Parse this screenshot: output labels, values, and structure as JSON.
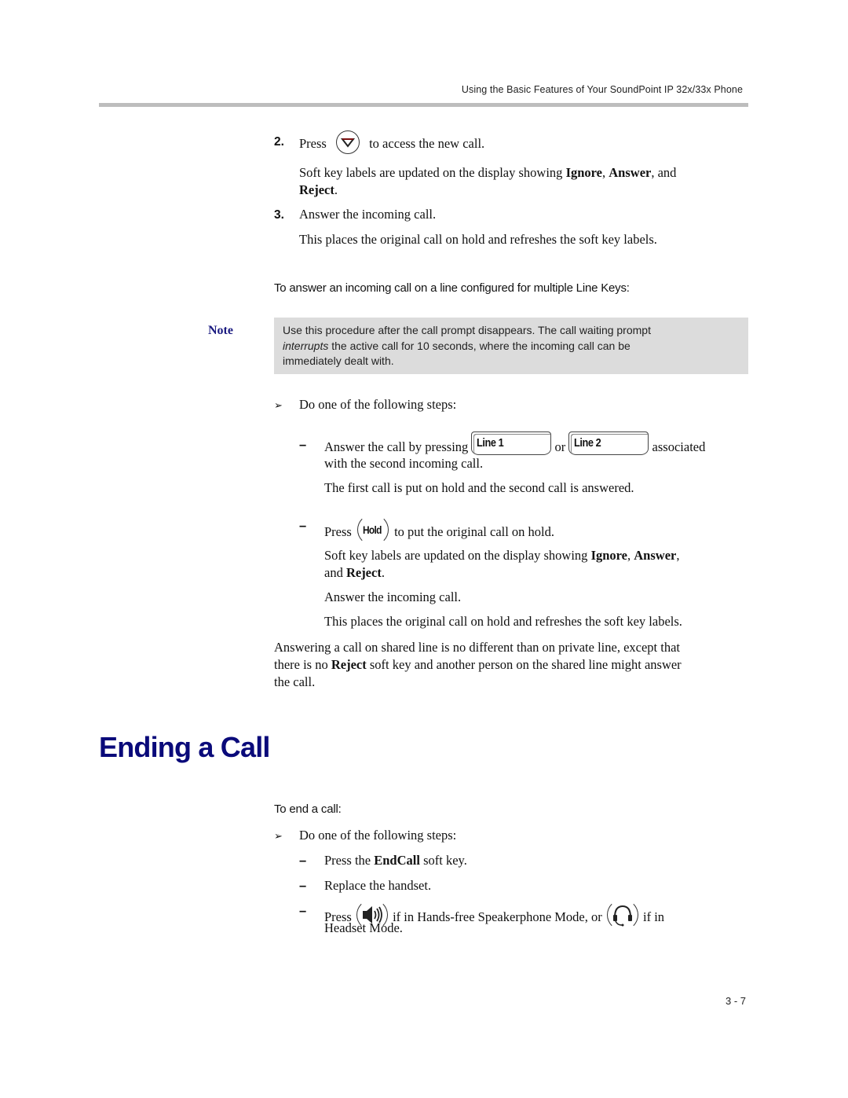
{
  "header": {
    "running_title": "Using the Basic Features of Your SoundPoint IP 32x/33x Phone"
  },
  "steps_top": [
    {
      "number": "2.",
      "pre": "Press",
      "icon": "down-arrow-key-icon",
      "post": "to access the new call.",
      "detail_pre": "Soft key labels are updated on the display showing ",
      "detail_bold1": "Ignore",
      "detail_sep1": ", ",
      "detail_bold2": "Answer",
      "detail_sep2": ", and",
      "detail_bold3": "Reject",
      "detail_end": "."
    },
    {
      "number": "3.",
      "text": "Answer the incoming call.",
      "detail": "This places the original call on hold and refreshes the soft key labels."
    }
  ],
  "procedure1": {
    "heading": "To answer an incoming call on a line configured for multiple Line Keys:",
    "note_label": "Note",
    "note_line1": "Use this procedure after the call prompt disappears. The call waiting prompt",
    "note_line2_italic": "interrupts",
    "note_line2_rest": " the active call for 10 seconds, where the incoming call can be",
    "note_line3": "immediately dealt with.",
    "bullet_marker": "➢",
    "bullet": "Do one of the following steps:",
    "options": [
      {
        "dash": "–",
        "pre": "Answer the call by pressing",
        "key1": "Line 1",
        "mid": "or",
        "key2": "Line 2",
        "post": "associated",
        "cont": "with the second incoming call.",
        "detail": "The first call is put on hold and the second call is answered."
      },
      {
        "dash": "–",
        "pre": "Press",
        "key": "Hold",
        "post": "to put the original call on hold.",
        "detail_pre": "Soft key labels are updated on the display showing ",
        "detail_bold1": "Ignore",
        "detail_sep1": ", ",
        "detail_bold2": "Answer",
        "detail_sep2": ",",
        "detail_line2_pre": "and ",
        "detail_bold3": "Reject",
        "detail_end": ".",
        "detail2": "Answer the incoming call.",
        "detail3": "This places the original call on hold and refreshes the soft key labels."
      }
    ],
    "shared_line_1": "Answering a call on shared line is no different than on private line, except that",
    "shared_line_2_pre": "there is no ",
    "shared_line_2_bold": "Reject",
    "shared_line_2_post": " soft key and another person on the shared line might answer",
    "shared_line_3": "the call."
  },
  "section": {
    "title": "Ending a Call",
    "procedure_heading": "To end a call:",
    "bullet_marker": "➢",
    "bullet": "Do one of the following steps:",
    "options": [
      {
        "dash": "–",
        "pre": "Press the ",
        "bold": "EndCall",
        "post": " soft key."
      },
      {
        "dash": "–",
        "text": "Replace the handset."
      },
      {
        "dash": "–",
        "pre": "Press",
        "icon1": "speakerphone-key-icon",
        "mid": "if in Hands-free Speakerphone Mode, or",
        "icon2": "headset-key-icon",
        "post": "if in",
        "cont": "Headset Mode."
      }
    ]
  },
  "footer": {
    "page_number": "3 - 7"
  }
}
